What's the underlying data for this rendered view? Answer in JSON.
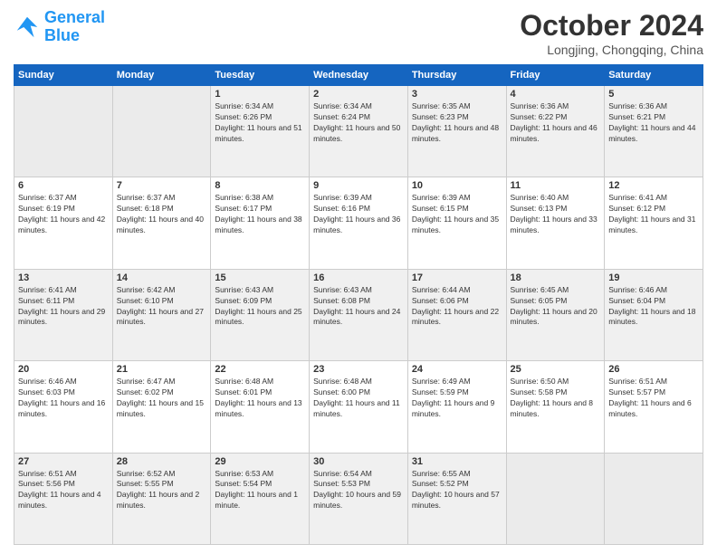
{
  "logo": {
    "line1": "General",
    "line2": "Blue"
  },
  "title": "October 2024",
  "location": "Longjing, Chongqing, China",
  "weekdays": [
    "Sunday",
    "Monday",
    "Tuesday",
    "Wednesday",
    "Thursday",
    "Friday",
    "Saturday"
  ],
  "weeks": [
    [
      {
        "day": "",
        "text": ""
      },
      {
        "day": "",
        "text": ""
      },
      {
        "day": "1",
        "text": "Sunrise: 6:34 AM\nSunset: 6:26 PM\nDaylight: 11 hours and 51 minutes."
      },
      {
        "day": "2",
        "text": "Sunrise: 6:34 AM\nSunset: 6:24 PM\nDaylight: 11 hours and 50 minutes."
      },
      {
        "day": "3",
        "text": "Sunrise: 6:35 AM\nSunset: 6:23 PM\nDaylight: 11 hours and 48 minutes."
      },
      {
        "day": "4",
        "text": "Sunrise: 6:36 AM\nSunset: 6:22 PM\nDaylight: 11 hours and 46 minutes."
      },
      {
        "day": "5",
        "text": "Sunrise: 6:36 AM\nSunset: 6:21 PM\nDaylight: 11 hours and 44 minutes."
      }
    ],
    [
      {
        "day": "6",
        "text": "Sunrise: 6:37 AM\nSunset: 6:19 PM\nDaylight: 11 hours and 42 minutes."
      },
      {
        "day": "7",
        "text": "Sunrise: 6:37 AM\nSunset: 6:18 PM\nDaylight: 11 hours and 40 minutes."
      },
      {
        "day": "8",
        "text": "Sunrise: 6:38 AM\nSunset: 6:17 PM\nDaylight: 11 hours and 38 minutes."
      },
      {
        "day": "9",
        "text": "Sunrise: 6:39 AM\nSunset: 6:16 PM\nDaylight: 11 hours and 36 minutes."
      },
      {
        "day": "10",
        "text": "Sunrise: 6:39 AM\nSunset: 6:15 PM\nDaylight: 11 hours and 35 minutes."
      },
      {
        "day": "11",
        "text": "Sunrise: 6:40 AM\nSunset: 6:13 PM\nDaylight: 11 hours and 33 minutes."
      },
      {
        "day": "12",
        "text": "Sunrise: 6:41 AM\nSunset: 6:12 PM\nDaylight: 11 hours and 31 minutes."
      }
    ],
    [
      {
        "day": "13",
        "text": "Sunrise: 6:41 AM\nSunset: 6:11 PM\nDaylight: 11 hours and 29 minutes."
      },
      {
        "day": "14",
        "text": "Sunrise: 6:42 AM\nSunset: 6:10 PM\nDaylight: 11 hours and 27 minutes."
      },
      {
        "day": "15",
        "text": "Sunrise: 6:43 AM\nSunset: 6:09 PM\nDaylight: 11 hours and 25 minutes."
      },
      {
        "day": "16",
        "text": "Sunrise: 6:43 AM\nSunset: 6:08 PM\nDaylight: 11 hours and 24 minutes."
      },
      {
        "day": "17",
        "text": "Sunrise: 6:44 AM\nSunset: 6:06 PM\nDaylight: 11 hours and 22 minutes."
      },
      {
        "day": "18",
        "text": "Sunrise: 6:45 AM\nSunset: 6:05 PM\nDaylight: 11 hours and 20 minutes."
      },
      {
        "day": "19",
        "text": "Sunrise: 6:46 AM\nSunset: 6:04 PM\nDaylight: 11 hours and 18 minutes."
      }
    ],
    [
      {
        "day": "20",
        "text": "Sunrise: 6:46 AM\nSunset: 6:03 PM\nDaylight: 11 hours and 16 minutes."
      },
      {
        "day": "21",
        "text": "Sunrise: 6:47 AM\nSunset: 6:02 PM\nDaylight: 11 hours and 15 minutes."
      },
      {
        "day": "22",
        "text": "Sunrise: 6:48 AM\nSunset: 6:01 PM\nDaylight: 11 hours and 13 minutes."
      },
      {
        "day": "23",
        "text": "Sunrise: 6:48 AM\nSunset: 6:00 PM\nDaylight: 11 hours and 11 minutes."
      },
      {
        "day": "24",
        "text": "Sunrise: 6:49 AM\nSunset: 5:59 PM\nDaylight: 11 hours and 9 minutes."
      },
      {
        "day": "25",
        "text": "Sunrise: 6:50 AM\nSunset: 5:58 PM\nDaylight: 11 hours and 8 minutes."
      },
      {
        "day": "26",
        "text": "Sunrise: 6:51 AM\nSunset: 5:57 PM\nDaylight: 11 hours and 6 minutes."
      }
    ],
    [
      {
        "day": "27",
        "text": "Sunrise: 6:51 AM\nSunset: 5:56 PM\nDaylight: 11 hours and 4 minutes."
      },
      {
        "day": "28",
        "text": "Sunrise: 6:52 AM\nSunset: 5:55 PM\nDaylight: 11 hours and 2 minutes."
      },
      {
        "day": "29",
        "text": "Sunrise: 6:53 AM\nSunset: 5:54 PM\nDaylight: 11 hours and 1 minute."
      },
      {
        "day": "30",
        "text": "Sunrise: 6:54 AM\nSunset: 5:53 PM\nDaylight: 10 hours and 59 minutes."
      },
      {
        "day": "31",
        "text": "Sunrise: 6:55 AM\nSunset: 5:52 PM\nDaylight: 10 hours and 57 minutes."
      },
      {
        "day": "",
        "text": ""
      },
      {
        "day": "",
        "text": ""
      }
    ]
  ]
}
